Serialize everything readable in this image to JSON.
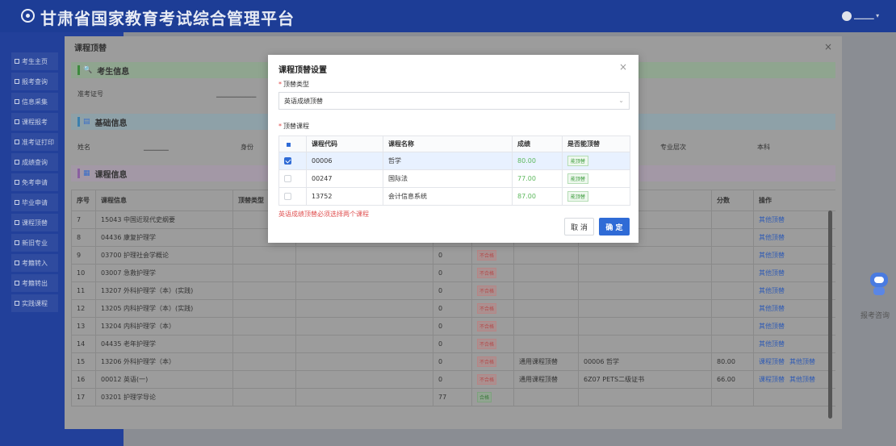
{
  "app": {
    "title": "甘肃省国家教育考试综合管理平台",
    "user_name": "▁▁▁▁ ▾"
  },
  "sidebar": {
    "items": [
      {
        "label": "考生主页"
      },
      {
        "label": "报考查询"
      },
      {
        "label": "信息采集"
      },
      {
        "label": "课程报考"
      },
      {
        "label": "准考证打印"
      },
      {
        "label": "成绩查询"
      },
      {
        "label": "免考申请"
      },
      {
        "label": "毕业申请"
      },
      {
        "label": "课程顶替"
      },
      {
        "label": "新旧专业"
      },
      {
        "label": "考籍转入"
      },
      {
        "label": "考籍转出"
      },
      {
        "label": "实践课程"
      }
    ]
  },
  "robot": {
    "label": "报考咨询"
  },
  "big_modal": {
    "title": "课程顶替",
    "close": "×",
    "sections": {
      "candidate": "考生信息",
      "basic": "基础信息",
      "course": "课程信息"
    },
    "candidate_fields": {
      "ticket_label": "准考证号",
      "ticket_value": "▁▁▁▁▁▁▁▁"
    },
    "basic_fields": {
      "name_label": "姓名",
      "name_value": "▁▁▁▁▁",
      "id_label": "身份",
      "level_label": "专业层次",
      "level_value": "本科"
    },
    "table": {
      "columns": [
        "序号",
        "课程信息",
        "顶替类型",
        "",
        "",
        "",
        "",
        "",
        "分数",
        "操作"
      ],
      "rows": [
        {
          "no": "7",
          "course": "15043 中国近现代史纲要",
          "score": "",
          "status": "",
          "type": "",
          "sub": "",
          "points": "",
          "ops": [
            "其他顶替"
          ]
        },
        {
          "no": "8",
          "course": "04436 康复护理学",
          "score": "",
          "status": "",
          "type": "",
          "sub": "",
          "points": "",
          "ops": [
            "其他顶替"
          ]
        },
        {
          "no": "9",
          "course": "03700 护理社会学概论",
          "score": "0",
          "status": "不合格",
          "type": "",
          "sub": "",
          "points": "",
          "ops": [
            "其他顶替"
          ]
        },
        {
          "no": "10",
          "course": "03007 急救护理学",
          "score": "0",
          "status": "不合格",
          "type": "",
          "sub": "",
          "points": "",
          "ops": [
            "其他顶替"
          ]
        },
        {
          "no": "11",
          "course": "13207 外科护理学（本）(实践)",
          "score": "0",
          "status": "不合格",
          "type": "",
          "sub": "",
          "points": "",
          "ops": [
            "其他顶替"
          ]
        },
        {
          "no": "12",
          "course": "13205 内科护理学（本）(实践)",
          "score": "0",
          "status": "不合格",
          "type": "",
          "sub": "",
          "points": "",
          "ops": [
            "其他顶替"
          ]
        },
        {
          "no": "13",
          "course": "13204 内科护理学（本）",
          "score": "0",
          "status": "不合格",
          "type": "",
          "sub": "",
          "points": "",
          "ops": [
            "其他顶替"
          ]
        },
        {
          "no": "14",
          "course": "04435 老年护理学",
          "score": "0",
          "status": "不合格",
          "type": "",
          "sub": "",
          "points": "",
          "ops": [
            "其他顶替"
          ]
        },
        {
          "no": "15",
          "course": "13206 外科护理学（本）",
          "score": "0",
          "status": "不合格",
          "type": "通用课程顶替",
          "sub": "00006 哲学",
          "points": "80.00",
          "ops": [
            "课程顶替",
            "其他顶替"
          ]
        },
        {
          "no": "16",
          "course": "00012 英语(一)",
          "score": "0",
          "status": "不合格",
          "type": "通用课程顶替",
          "sub": "6Z07 PETS二级证书",
          "points": "66.00",
          "ops": [
            "课程顶替",
            "其他顶替"
          ]
        },
        {
          "no": "17",
          "course": "03201 护理学导论",
          "score": "77",
          "status": "合格",
          "type": "",
          "sub": "",
          "points": "",
          "ops": []
        }
      ]
    }
  },
  "dialog": {
    "title": "课程顶替设置",
    "close": "×",
    "type_label": "顶替类型",
    "type_value": "英语成绩顶替",
    "course_label": "顶替课程",
    "columns": [
      "课程代码",
      "课程名称",
      "成绩",
      "是否能顶替"
    ],
    "rows": [
      {
        "code": "00006",
        "name": "哲学",
        "score": "80.00",
        "can": "能顶替",
        "checked": true
      },
      {
        "code": "00247",
        "name": "国际法",
        "score": "77.00",
        "can": "能顶替",
        "checked": false
      },
      {
        "code": "13752",
        "name": "会计信息系统",
        "score": "87.00",
        "can": "能顶替",
        "checked": false
      }
    ],
    "warning": "英语成绩顶替必须选择两个课程",
    "cancel": "取 消",
    "ok": "确 定"
  },
  "colors": {
    "header": "#1d3d96",
    "accent": "#2f6bd6",
    "warning": "#e05252"
  }
}
